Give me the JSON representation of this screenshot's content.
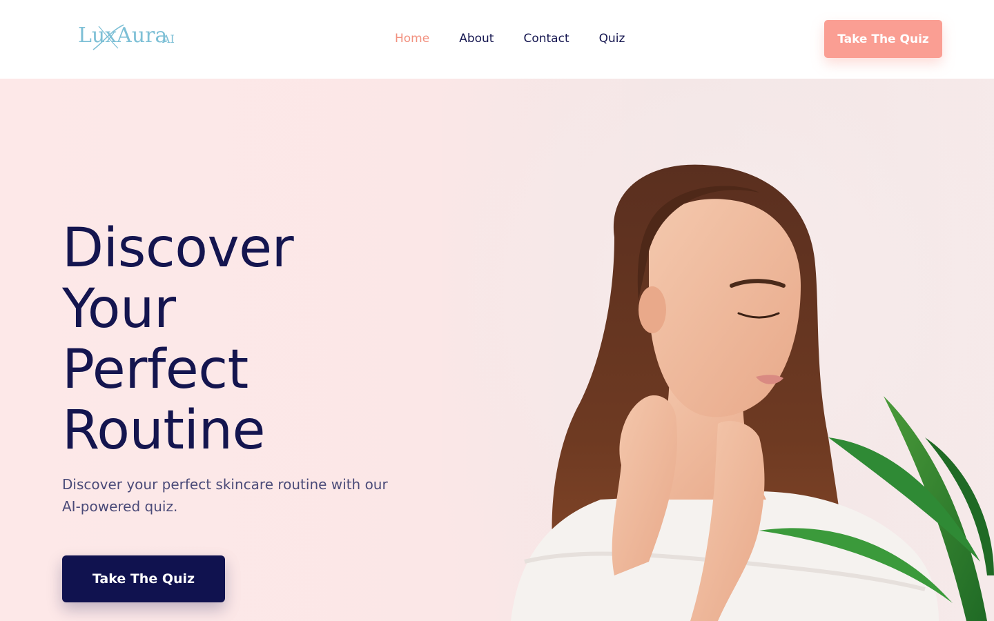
{
  "header": {
    "logo_text": "LuxAura",
    "logo_suffix": "AI",
    "nav": [
      {
        "label": "Home",
        "active": true
      },
      {
        "label": "About",
        "active": false
      },
      {
        "label": "Contact",
        "active": false
      },
      {
        "label": "Quiz",
        "active": false
      }
    ],
    "cta_label": "Take The Quiz"
  },
  "hero": {
    "title_lines": [
      "Discover",
      "Your",
      "Perfect",
      "Routine"
    ],
    "subtitle": "Discover your perfect skincare routine with our AI-powered quiz.",
    "cta_label": "Take The Quiz"
  },
  "colors": {
    "accent": "#fa9e93",
    "nav_active": "#f2917f",
    "primary": "#10124f",
    "hero_bg": "#fde8e8"
  },
  "icons": {
    "logo": "luxaura-logo-icon"
  }
}
